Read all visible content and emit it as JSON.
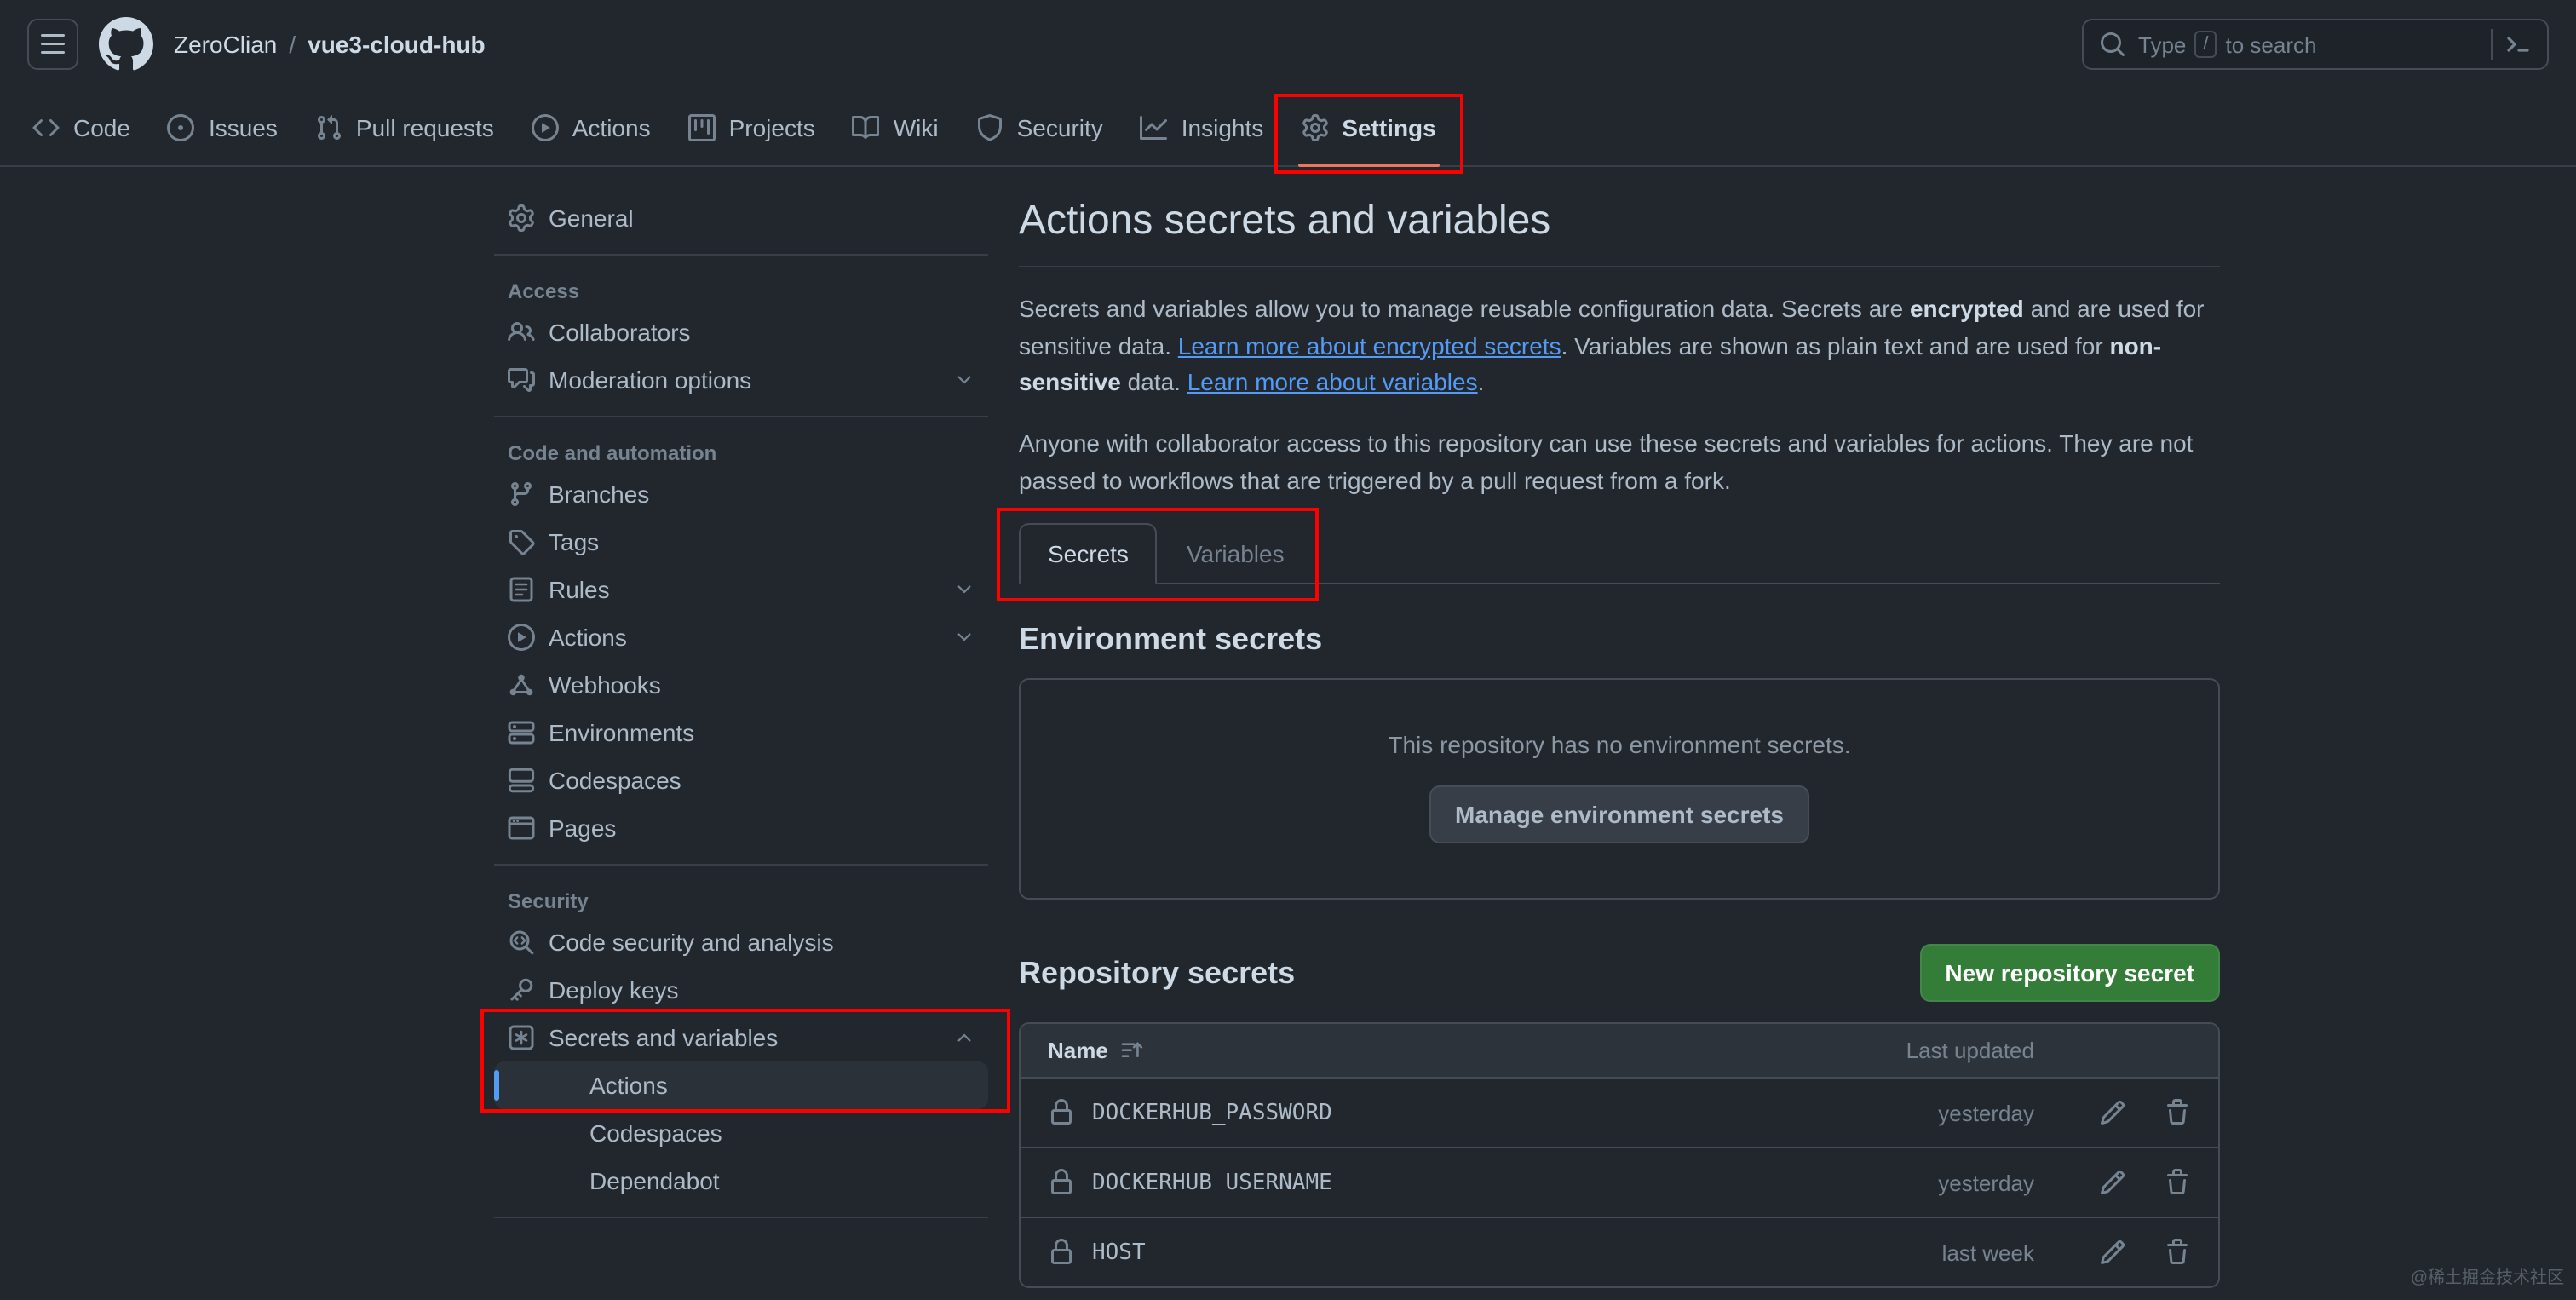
{
  "header": {
    "breadcrumb": {
      "owner": "ZeroClian",
      "separator": "/",
      "repo": "vue3-cloud-hub"
    },
    "search": {
      "prefix": "Type",
      "slash_key": "/",
      "suffix": "to search"
    },
    "icons": {
      "menu": "three-bars-icon",
      "logo": "github-mark-icon",
      "search": "search-icon",
      "command": "command-palette-icon"
    }
  },
  "repo_nav": {
    "tabs": [
      {
        "label": "Code",
        "icon": "code-icon",
        "active": false
      },
      {
        "label": "Issues",
        "icon": "issue-opened-icon",
        "active": false
      },
      {
        "label": "Pull requests",
        "icon": "git-pull-request-icon",
        "active": false
      },
      {
        "label": "Actions",
        "icon": "play-icon",
        "active": false
      },
      {
        "label": "Projects",
        "icon": "project-icon",
        "active": false
      },
      {
        "label": "Wiki",
        "icon": "book-icon",
        "active": false
      },
      {
        "label": "Security",
        "icon": "shield-icon",
        "active": false
      },
      {
        "label": "Insights",
        "icon": "graph-icon",
        "active": false
      },
      {
        "label": "Settings",
        "icon": "gear-icon",
        "active": true,
        "annotated": true
      }
    ]
  },
  "sidebar": {
    "general": {
      "label": "General",
      "icon": "gear-icon"
    },
    "sections": [
      {
        "title": "Access",
        "items": [
          {
            "label": "Collaborators",
            "icon": "people-icon"
          },
          {
            "label": "Moderation options",
            "icon": "comment-discussion-icon",
            "chevron": "down"
          }
        ]
      },
      {
        "title": "Code and automation",
        "items": [
          {
            "label": "Branches",
            "icon": "git-branch-icon"
          },
          {
            "label": "Tags",
            "icon": "tag-icon"
          },
          {
            "label": "Rules",
            "icon": "rules-icon",
            "chevron": "down"
          },
          {
            "label": "Actions",
            "icon": "play-icon",
            "chevron": "down"
          },
          {
            "label": "Webhooks",
            "icon": "webhook-icon"
          },
          {
            "label": "Environments",
            "icon": "server-icon"
          },
          {
            "label": "Codespaces",
            "icon": "codespaces-icon"
          },
          {
            "label": "Pages",
            "icon": "browser-icon"
          }
        ]
      },
      {
        "title": "Security",
        "items": [
          {
            "label": "Code security and analysis",
            "icon": "codescan-icon"
          },
          {
            "label": "Deploy keys",
            "icon": "key-icon"
          },
          {
            "label": "Secrets and variables",
            "icon": "asterisk-box-icon",
            "chevron": "up",
            "expanded": true,
            "annotated": true
          }
        ],
        "subitems": [
          {
            "label": "Actions",
            "active": true
          },
          {
            "label": "Codespaces",
            "active": false
          },
          {
            "label": "Dependabot",
            "active": false
          }
        ]
      }
    ]
  },
  "main": {
    "title": "Actions secrets and variables",
    "intro": {
      "p1_text1": "Secrets and variables allow you to manage reusable configuration data. Secrets are ",
      "p1_bold1": "encrypted",
      "p1_text2": " and are used for sensitive data. ",
      "p1_link1": "Learn more about encrypted secrets",
      "p1_text3": ". Variables are shown as plain text and are used for ",
      "p1_bold2": "non-sensitive",
      "p1_text4": " data. ",
      "p1_link2": "Learn more about variables",
      "p1_text5": ".",
      "p2": "Anyone with collaborator access to this repository can use these secrets and variables for actions. They are not passed to workflows that are triggered by a pull request from a fork."
    },
    "tabs": [
      {
        "label": "Secrets",
        "active": true,
        "annotated": true
      },
      {
        "label": "Variables",
        "active": false,
        "annotated": true
      }
    ],
    "environment_secrets": {
      "heading": "Environment secrets",
      "empty_message": "This repository has no environment secrets.",
      "manage_button": "Manage environment secrets"
    },
    "repository_secrets": {
      "heading": "Repository secrets",
      "new_button": "New repository secret",
      "table": {
        "name_header": "Name",
        "updated_header": "Last updated",
        "icons": {
          "name_sort": "sort-ascending-icon",
          "secret": "lock-icon",
          "edit": "pencil-icon",
          "delete": "trash-icon"
        },
        "rows": [
          {
            "name": "DOCKERHUB_PASSWORD",
            "updated": "yesterday"
          },
          {
            "name": "DOCKERHUB_USERNAME",
            "updated": "yesterday"
          },
          {
            "name": "HOST",
            "updated": "last week"
          }
        ]
      }
    }
  },
  "watermark": "@稀土掘金技术社区",
  "colors": {
    "canvas": "#22272e",
    "canvas_subtle": "#2d333b",
    "border": "#444c56",
    "border_muted": "#373e47",
    "fg_default": "#adbac7",
    "fg_muted": "#768390",
    "fg_bright": "#cdd9e5",
    "accent_link": "#539bf5",
    "active_nav_underline": "#ec775c",
    "success_button": "#347d39",
    "annotation": "#ff0000",
    "active_sidebar_bar": "#539bf5"
  }
}
